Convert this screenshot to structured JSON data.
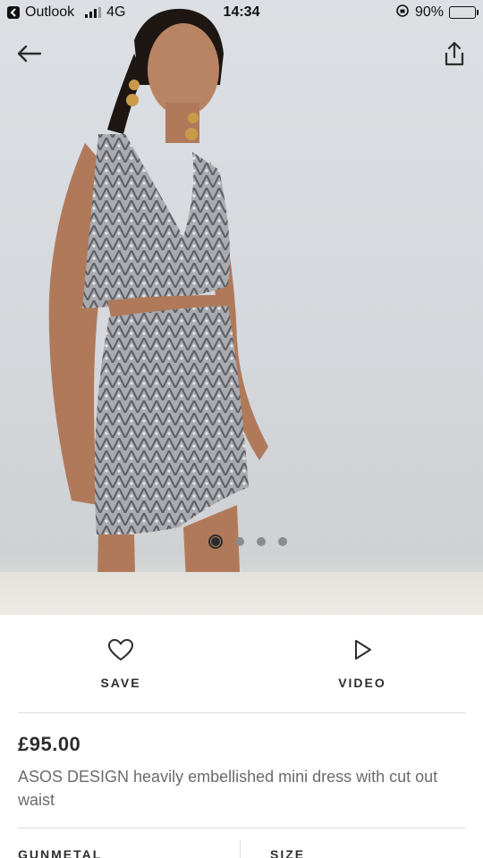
{
  "status_bar": {
    "back_app": "Outlook",
    "network": "4G",
    "time": "14:34",
    "battery": "90%",
    "battery_level": 0.9
  },
  "hero": {
    "dots_count": 4,
    "active_dot": 0
  },
  "actions": {
    "save_label": "SAVE",
    "video_label": "VIDEO"
  },
  "product": {
    "price": "£95.00",
    "title": "ASOS DESIGN heavily embellished mini dress with cut out waist"
  },
  "options": {
    "colour_label": "GUNMETAL",
    "size_label": "SIZE"
  },
  "icons": {
    "back": "arrow-left-icon",
    "share": "share-icon",
    "save": "heart-icon",
    "video": "play-icon"
  }
}
